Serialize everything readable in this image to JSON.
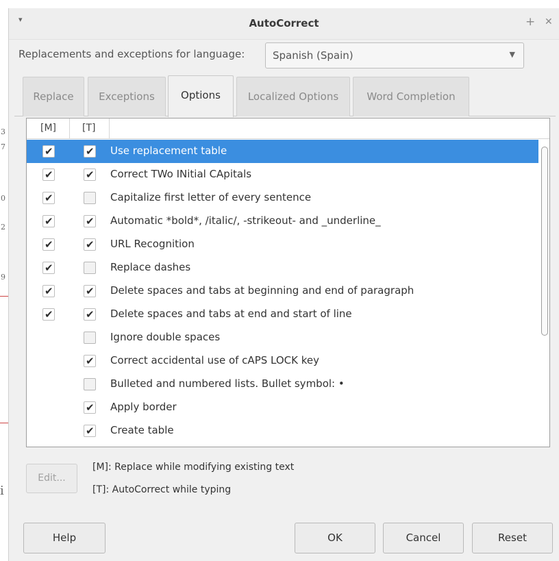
{
  "dialog": {
    "title": "AutoCorrect",
    "pin_glyph": "+",
    "close_glyph": "✕",
    "menu_glyph": "▾"
  },
  "language": {
    "label": "Replacements and exceptions for language:",
    "selected": "Spanish (Spain)"
  },
  "tabs": [
    {
      "label": "Replace",
      "active": false
    },
    {
      "label": "Exceptions",
      "active": false
    },
    {
      "label": "Options",
      "active": true
    },
    {
      "label": "Localized Options",
      "active": false
    },
    {
      "label": "Word Completion",
      "active": false
    }
  ],
  "list": {
    "col_m": "[M]",
    "col_t": "[T]",
    "selected_index": 0,
    "rows": [
      {
        "label": "Use replacement table",
        "m": true,
        "t": true
      },
      {
        "label": "Correct TWo INitial CApitals",
        "m": true,
        "t": true
      },
      {
        "label": "Capitalize first letter of every sentence",
        "m": true,
        "t": false
      },
      {
        "label": "Automatic *bold*, /italic/, -strikeout- and _underline_",
        "m": true,
        "t": true
      },
      {
        "label": "URL Recognition",
        "m": true,
        "t": true
      },
      {
        "label": "Replace dashes",
        "m": true,
        "t": false
      },
      {
        "label": "Delete spaces and tabs at beginning and end of paragraph",
        "m": true,
        "t": true
      },
      {
        "label": "Delete spaces and tabs at end and start of line",
        "m": true,
        "t": true
      },
      {
        "label": "Ignore double spaces",
        "m": null,
        "t": false
      },
      {
        "label": "Correct accidental use of cAPS LOCK key",
        "m": null,
        "t": true
      },
      {
        "label": "Bulleted and numbered lists. Bullet symbol: •",
        "m": null,
        "t": false
      },
      {
        "label": "Apply border",
        "m": null,
        "t": true
      },
      {
        "label": "Create table",
        "m": null,
        "t": true
      }
    ]
  },
  "edit_button": "Edit...",
  "legend": {
    "m": "[M]: Replace while modifying existing text",
    "t": "[T]: AutoCorrect while typing"
  },
  "buttons": {
    "help": "Help",
    "ok": "OK",
    "cancel": "Cancel",
    "reset": "Reset"
  },
  "background_marks": [
    "3",
    "7",
    "0",
    "2",
    "9",
    "i"
  ],
  "colors": {
    "selection": "#3b8ee0",
    "dialog_bg": "#f0f0f0"
  }
}
